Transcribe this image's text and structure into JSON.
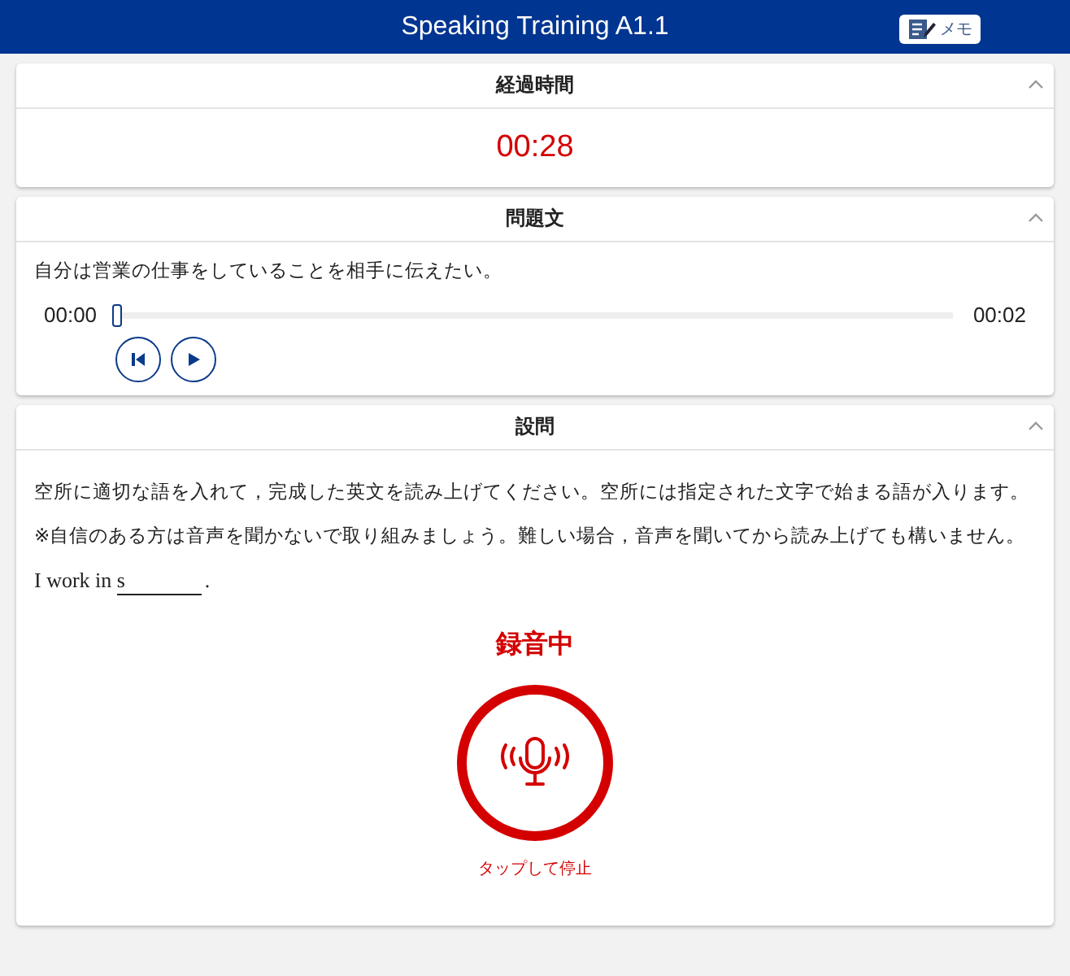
{
  "header": {
    "title": "Speaking Training A1.1",
    "memo_button": "メモ"
  },
  "panels": [
    {
      "kind": "timer",
      "title": "経過時間",
      "expanded": true,
      "time": "00:28"
    },
    {
      "kind": "audio",
      "title": "問題文",
      "expanded": true,
      "text": "自分は営業の仕事をしていることを相手に伝えたい。",
      "current": "00:00",
      "duration": "00:02",
      "level": 0
    },
    {
      "kind": "question",
      "title": "設問",
      "expanded": true,
      "instructions": [
        "空所に適切な語を入れて，完成した英文を読み上げてください。空所には指定された文字で始まる語が入ります。",
        "※自信のある方は音声を聞かないで取り組みましょう。難しい場合，音声を聞いてから読み上げても構いません。"
      ],
      "sentence": {
        "before": "I work in ",
        "hint": "s",
        "after": "."
      },
      "recording": true,
      "status": "録音中",
      "action": "タップして停止"
    }
  ]
}
